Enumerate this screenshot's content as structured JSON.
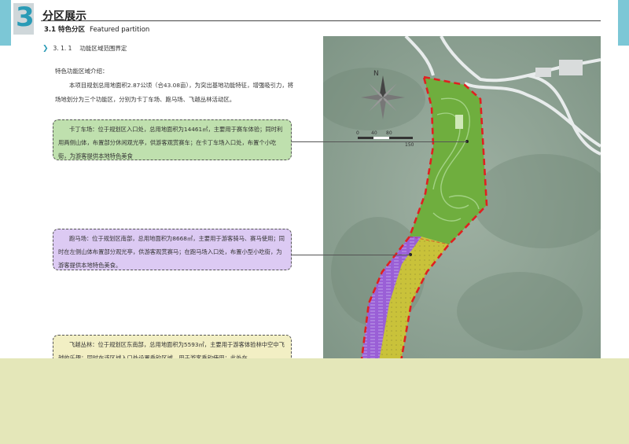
{
  "header": {
    "section_number": "3",
    "chapter_title": "分区展示",
    "subtitle_cn": "3.1 特色分区",
    "subtitle_en": "Featured partition",
    "subsub_number": "3. 1. 1",
    "subsub_title": "功能区域范围界定"
  },
  "intro": {
    "title": "特色功能区域介绍：",
    "body": "本项目规划总用地面积2.87公顷（合43.08亩），为突出基地功能特征，增强吸引力，将场地划分为三个功能区，分别为卡丁车场、跑马场、飞越丛林活动区。"
  },
  "zones": {
    "go_kart": "卡丁车场：位于规划区入口处，总用地面积为14461㎡，主要用于赛车体验；同时利用两侧山体，布置部分休闲观光亭，供游客观赏赛车；在卡丁车场入口处，布置个小吃街，为游客提供本地特色美食",
    "horse": "跑马场：位于规划区南部，总用地面积为8668㎡，主要用于游客骑马、赛马使用；同时在左侧山体布置部分观光亭，供游客观赏赛马；在跑马场入口处，布置小型小吃街，为游客提供本地特色美食。",
    "jungle": "飞越丛林：位于规划区东南部，总用地面积为5593㎡，主要用于游客体验林中空中飞越的乐趣；同时在该区域入口处设置垂钓区域，用于游客垂钓使用；此外在"
  },
  "map": {
    "north_label": "N",
    "scale_labels": [
      "0",
      "40",
      "80",
      "150"
    ]
  },
  "colors": {
    "accent": "#2a9bb6",
    "green_zone": "#6fae3e",
    "purple_zone": "#9a5fd6",
    "yellow_zone": "#c9c23a",
    "boundary": "#e02020"
  }
}
